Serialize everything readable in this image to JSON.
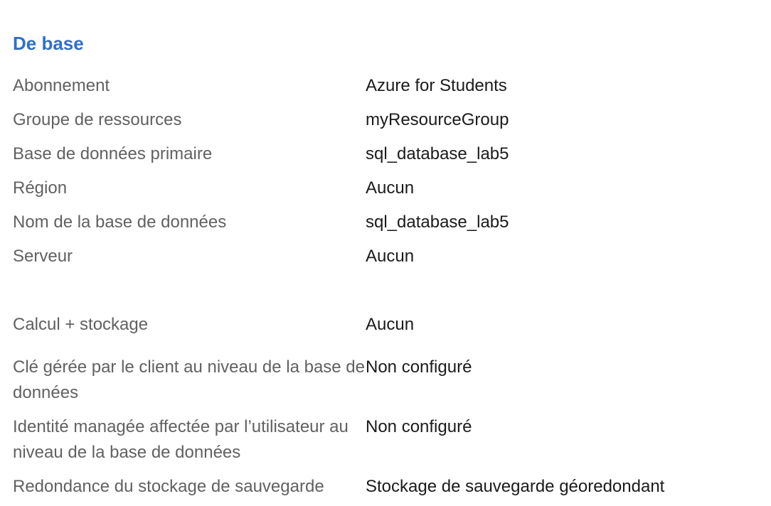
{
  "section": {
    "title": "De base"
  },
  "rows": [
    {
      "label": "Abonnement",
      "value": "Azure for Students"
    },
    {
      "label": "Groupe de ressources",
      "value": "myResourceGroup"
    },
    {
      "label": "Base de données primaire",
      "value": "sql_database_lab5"
    },
    {
      "label": "Région",
      "value": "Aucun"
    },
    {
      "label": "Nom de la base de données",
      "value": "sql_database_lab5"
    },
    {
      "label": "Serveur",
      "value": "Aucun"
    },
    {
      "label": "Calcul + stockage",
      "value": "Aucun"
    },
    {
      "label": "Clé gérée par le client au niveau de la base de données",
      "value": "Non configuré"
    },
    {
      "label": "Identité managée affectée par l’utilisateur au niveau de la base de données",
      "value": "Non configuré"
    },
    {
      "label": "Redondance du stockage de sauvegarde",
      "value": "Stockage de sauvegarde géoredondant"
    }
  ],
  "colors": {
    "title": "#2f6fca",
    "label": "#616161",
    "value": "#1b1b1b"
  }
}
